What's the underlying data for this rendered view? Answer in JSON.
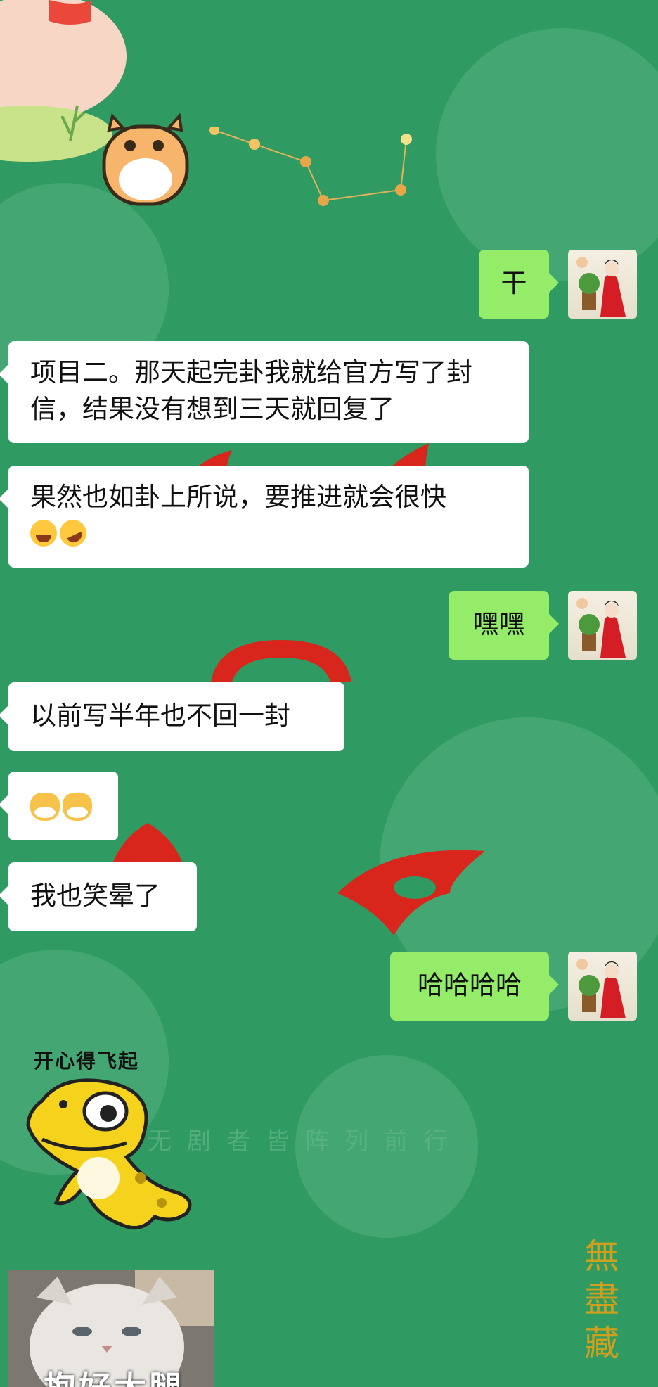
{
  "chat": {
    "messages": [
      {
        "side": "sent",
        "text": "干"
      },
      {
        "side": "received",
        "text": "项目二。那天起完卦我就给官方写了封信，结果没有想到三天就回复了"
      },
      {
        "side": "received",
        "text": "果然也如卦上所说，要推进就会很快",
        "emoji": [
          "laugh-crying-emoji",
          "rolling-laugh-emoji"
        ]
      },
      {
        "side": "sent",
        "text": "嘿嘿"
      },
      {
        "side": "received",
        "text": "以前写半年也不回一封"
      },
      {
        "side": "received",
        "emoji": [
          "cat-emoji",
          "cat-emoji"
        ]
      },
      {
        "side": "received",
        "text": "我也笑晕了"
      },
      {
        "side": "sent",
        "text": "哈哈哈哈"
      }
    ],
    "stickers": {
      "gecko_caption": "开心得飞起",
      "cat_caption": "抱好大腿"
    }
  },
  "background": {
    "faint_text": "无剧者皆阵列前行",
    "seal_text": "無盡藏"
  },
  "colors": {
    "background": "#2f9a62",
    "sent_bubble": "#95ec69",
    "received_bubble": "#ffffff"
  }
}
